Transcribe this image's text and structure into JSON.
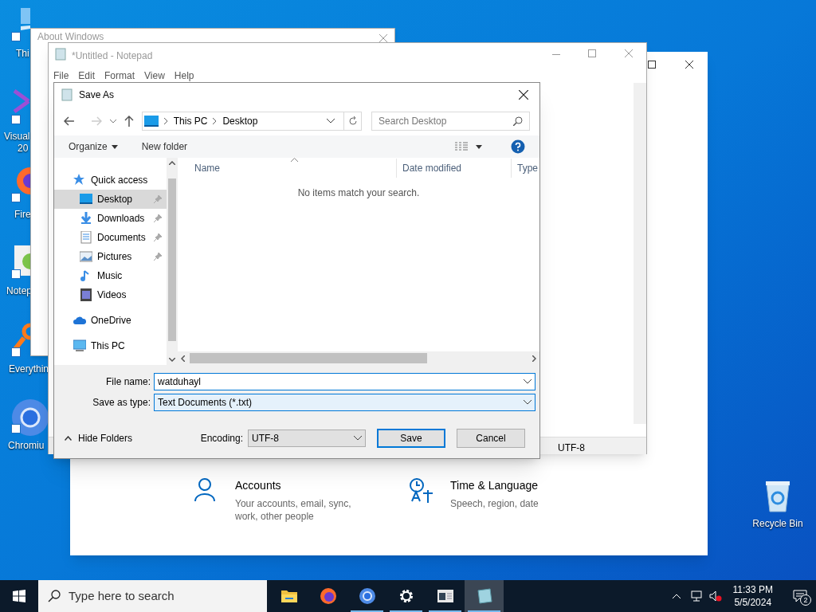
{
  "desktop_icons": [
    {
      "kind": "monitor",
      "lines": [
        "Thi"
      ]
    },
    {
      "kind": "vs",
      "lines": [
        "Visual",
        "20"
      ]
    },
    {
      "kind": "firefox",
      "lines": [
        "Fire"
      ]
    },
    {
      "kind": "notepadpp",
      "lines": [
        "Notep"
      ]
    },
    {
      "kind": "everything",
      "lines": [
        "Everythin"
      ]
    },
    {
      "kind": "chromium",
      "lines": [
        "Chromiu"
      ]
    }
  ],
  "recycle_bin": {
    "label": "Recycle Bin"
  },
  "settings_window": {
    "items": [
      {
        "kind": "person",
        "title": "Accounts",
        "description": "Your accounts, email, sync, work, other people"
      },
      {
        "kind": "language",
        "title": "Time & Language",
        "description": "Speech, region, date"
      }
    ]
  },
  "about_window": {
    "title": "About Windows"
  },
  "notepad": {
    "title": "*Untitled - Notepad",
    "menu": [
      "File",
      "Edit",
      "Format",
      "View",
      "Help"
    ],
    "status_encoding": "UTF-8"
  },
  "save_dialog": {
    "title": "Save As",
    "breadcrumb": [
      "This PC",
      "Desktop"
    ],
    "search": {
      "placeholder": "Search Desktop"
    },
    "toolbar": [
      "Organize",
      "New folder"
    ],
    "nav": [
      {
        "kind": "star",
        "label": "Quick access",
        "selected": false,
        "children": [
          {
            "kind": "desktop",
            "label": "Desktop",
            "selected": true,
            "pinned": true
          },
          {
            "kind": "download",
            "label": "Downloads",
            "selected": false,
            "pinned": true
          },
          {
            "kind": "document",
            "label": "Documents",
            "selected": false,
            "pinned": true
          },
          {
            "kind": "picture",
            "label": "Pictures",
            "selected": false,
            "pinned": true
          },
          {
            "kind": "music",
            "label": "Music",
            "selected": false,
            "pinned": false
          },
          {
            "kind": "video",
            "label": "Videos",
            "selected": false,
            "pinned": false
          }
        ]
      },
      {
        "kind": "cloud",
        "label": "OneDrive",
        "selected": false
      },
      {
        "kind": "pc",
        "label": "This PC",
        "selected": false
      }
    ],
    "columns": [
      "Name",
      "Date modified",
      "Type"
    ],
    "empty_message": "No items match your search.",
    "file_name": {
      "label": "File name:",
      "value": "watduhayl"
    },
    "save_type": {
      "label": "Save as type:",
      "value": "Text Documents (*.txt)"
    },
    "hide_folders": "Hide Folders",
    "encoding": {
      "label": "Encoding:",
      "value": "UTF-8"
    },
    "buttons": [
      "Save",
      "Cancel"
    ]
  },
  "taskbar": {
    "search": {
      "placeholder": "Type here to search"
    },
    "apps": [
      {
        "kind": "folder",
        "running": false,
        "active": false
      },
      {
        "kind": "firefox",
        "running": false,
        "active": false
      },
      {
        "kind": "chromium",
        "running": true,
        "active": false
      },
      {
        "kind": "gear",
        "running": true,
        "active": false
      },
      {
        "kind": "window",
        "running": true,
        "active": false
      },
      {
        "kind": "notepad",
        "running": true,
        "active": true
      }
    ],
    "time": "11:33 PM",
    "date": "5/5/2024",
    "notifications": "2"
  }
}
